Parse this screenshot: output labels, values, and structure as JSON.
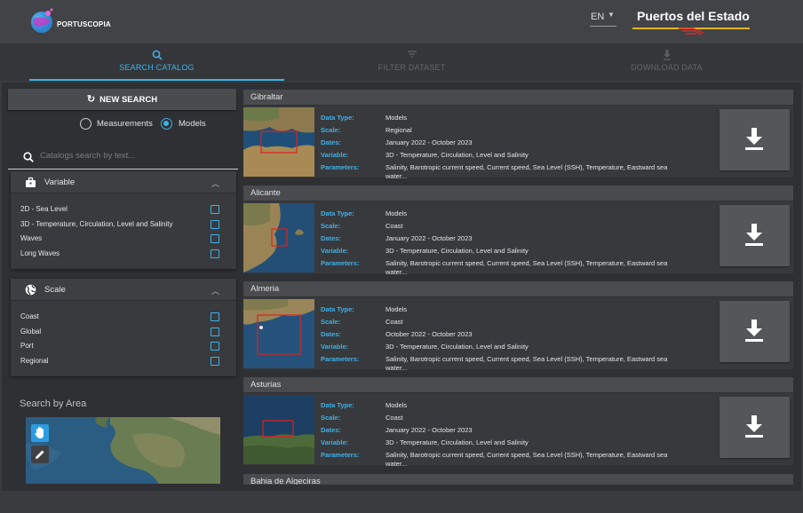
{
  "header": {
    "logo_text": "PORTUSCOPIA",
    "language": "EN",
    "brand": "Puertos del Estado"
  },
  "tabs": [
    {
      "label": "SEARCH CATALOG",
      "icon": "search-icon",
      "active": true
    },
    {
      "label": "FILTER DATASET",
      "icon": "filter-icon",
      "active": false
    },
    {
      "label": "DOWNLOAD DATA",
      "icon": "download-icon",
      "active": false
    }
  ],
  "sidebar": {
    "new_search_label": "NEW SEARCH",
    "mode_options": [
      {
        "label": "Measurements",
        "selected": false
      },
      {
        "label": "Models",
        "selected": true
      }
    ],
    "search_placeholder": "Catalogs search by text...",
    "variable_panel": {
      "title": "Variable",
      "options": [
        "2D - Sea Level",
        "3D - Temperature, Circulation, Level and Salinity",
        "Waves",
        "Long Waves"
      ]
    },
    "scale_panel": {
      "title": "Scale",
      "options": [
        "Coast",
        "Global",
        "Port",
        "Regional"
      ]
    },
    "area_title": "Search by Area"
  },
  "field_labels": {
    "data_type": "Data Type:",
    "scale": "Scale:",
    "dates": "Dates:",
    "variable": "Variable:",
    "parameters": "Parameters:"
  },
  "results": [
    {
      "title": "Gibraltar",
      "data_type": "Models",
      "scale": "Regional",
      "dates": "January 2022 - October 2023",
      "variable": "3D - Temperature, Circulation, Level and Salinity",
      "parameters": "Salinity, Barotropic current speed, Current speed, Sea Level (SSH), Temperature, Eastward sea water..."
    },
    {
      "title": "Alicante",
      "data_type": "Models",
      "scale": "Coast",
      "dates": "January 2022 - October 2023",
      "variable": "3D - Temperature, Circulation, Level and Salinity",
      "parameters": "Salinity, Barotropic current speed, Current speed, Sea Level (SSH), Temperature, Eastward sea water..."
    },
    {
      "title": "Almeria",
      "data_type": "Models",
      "scale": "Coast",
      "dates": "October 2022 - October 2023",
      "variable": "3D - Temperature, Circulation, Level and Salinity",
      "parameters": "Salinity, Barotropic current speed, Current speed, Sea Level (SSH), Temperature, Eastward sea water..."
    },
    {
      "title": "Asturias",
      "data_type": "Models",
      "scale": "Coast",
      "dates": "January 2022 - October 2023",
      "variable": "3D - Temperature, Circulation, Level and Salinity",
      "parameters": "Salinity, Barotropic current speed, Current speed, Sea Level (SSH), Temperature, Eastward sea water..."
    },
    {
      "title": "Bahia de Algeciras"
    }
  ],
  "colors": {
    "accent": "#3db2ea",
    "brand_line": "#e3b516",
    "bbox": "#e02020"
  }
}
